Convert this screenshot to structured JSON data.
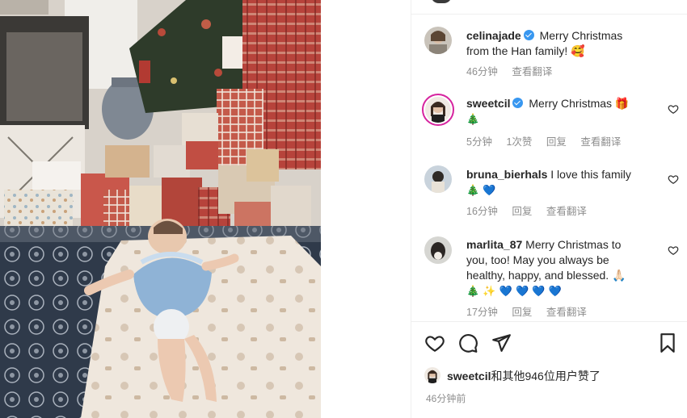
{
  "comments": [
    {
      "username": "celinajade",
      "verified": true,
      "text_line1": "Merry Christmas",
      "text_line2": "from the Han family! 🥰",
      "time": "46分钟",
      "translate": "查看翻译"
    },
    {
      "username": "sweetcil",
      "verified": true,
      "text_line1": "Merry Christmas 🎁",
      "text_line2": "🎄",
      "time": "5分钟",
      "likes": "1次赞",
      "reply": "回复",
      "translate": "查看翻译"
    },
    {
      "username": "bruna_bierhals",
      "verified": false,
      "text_line1": "I love this family",
      "text_line2": "🎄 💙",
      "time": "16分钟",
      "reply": "回复",
      "translate": "查看翻译"
    },
    {
      "username": "marlita_87",
      "verified": false,
      "text_line1": "Merry Christmas to",
      "text_line2": "you, too! May you always be",
      "text_line3": "healthy, happy, and blessed. 🙏🏻",
      "text_line4": "🎄 ✨ 💙 💙 💙 💙",
      "time": "17分钟",
      "reply": "回复",
      "translate": "查看翻译"
    }
  ],
  "likes_summary": {
    "user": "sweetcil",
    "rest": "和其他946位用户赞了"
  },
  "post_time": "46分钟前",
  "icons": {
    "like": "heart-outline-icon",
    "comment": "comment-bubble-icon",
    "share": "paper-plane-icon",
    "save": "bookmark-icon",
    "verified": "verified-badge-icon"
  },
  "colors": {
    "text": "#262626",
    "meta": "#8e8e8e",
    "verified": "#3897f0",
    "heart_blue": "#3a8ee6",
    "divider": "#efefef"
  }
}
